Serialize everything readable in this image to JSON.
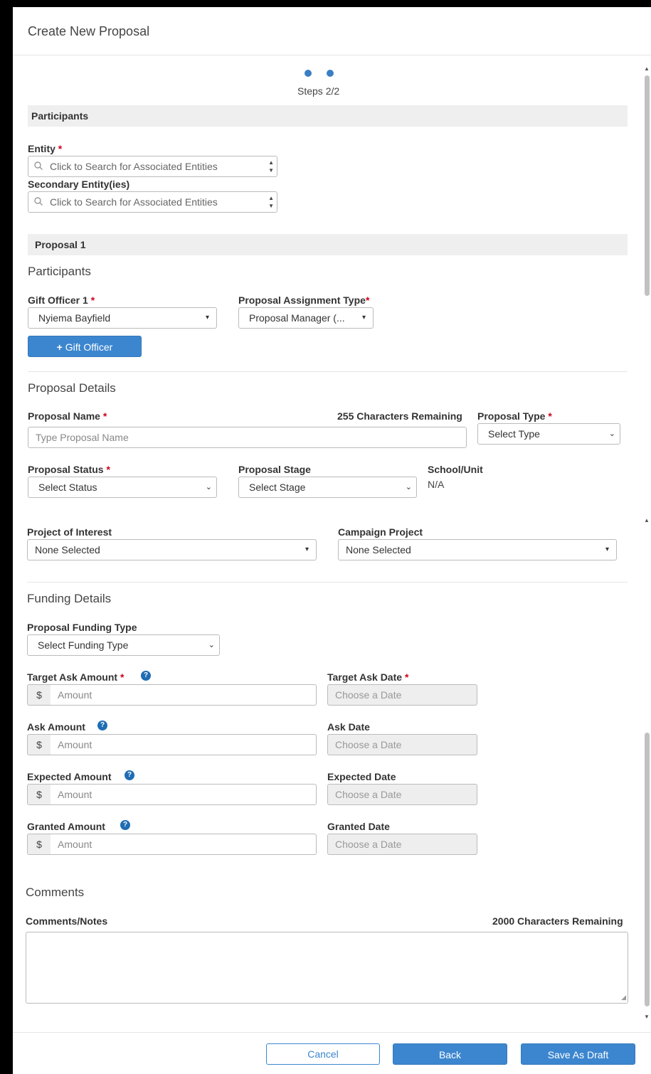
{
  "modal": {
    "title": "Create New Proposal"
  },
  "steps": {
    "text": "Steps 2/2"
  },
  "participants_section": {
    "title": "Participants",
    "entity_label": "Entity",
    "entity_placeholder": "Click to Search for Associated Entities",
    "secondary_label": "Secondary Entity(ies)",
    "secondary_placeholder": "Click to Search for Associated Entities",
    "required_mark": "*"
  },
  "proposal_section": {
    "title": "Proposal 1",
    "participants_subhead": "Participants",
    "gift_officer_label": "Gift Officer 1",
    "gift_officer_value": "Nyiema Bayfield",
    "assignment_type_label": "Proposal Assignment Type",
    "assignment_type_value": "Proposal Manager (...",
    "add_gift_officer_button": "Gift Officer",
    "details_subhead": "Proposal Details",
    "proposal_name_label": "Proposal Name",
    "proposal_name_remaining": "255 Characters Remaining",
    "proposal_name_placeholder": "Type Proposal Name",
    "proposal_type_label": "Proposal Type",
    "proposal_type_value": "Select Type",
    "status_label": "Proposal Status",
    "status_value": "Select Status",
    "stage_label": "Proposal Stage",
    "stage_value": "Select Stage",
    "school_label": "School/Unit",
    "school_value": "N/A",
    "project_interest_label": "Project of Interest",
    "project_interest_value": "None Selected",
    "campaign_project_label": "Campaign Project",
    "campaign_project_value": "None Selected"
  },
  "funding": {
    "subhead": "Funding Details",
    "funding_type_label": "Proposal Funding Type",
    "funding_type_value": "Select Funding Type",
    "currency_symbol": "$",
    "amount_placeholder": "Amount",
    "date_placeholder": "Choose a Date",
    "target_ask_amount_label": "Target Ask Amount",
    "target_ask_date_label": "Target Ask Date",
    "ask_amount_label": "Ask Amount",
    "ask_date_label": "Ask Date",
    "expected_amount_label": "Expected Amount",
    "expected_date_label": "Expected Date",
    "granted_amount_label": "Granted Amount",
    "granted_date_label": "Granted Date",
    "help_glyph": "?"
  },
  "comments": {
    "subhead": "Comments",
    "notes_label": "Comments/Notes",
    "remaining": "2000 Characters Remaining"
  },
  "footer": {
    "cancel": "Cancel",
    "back": "Back",
    "save_draft": "Save As Draft"
  },
  "colors": {
    "accent": "#3c86cf",
    "required": "#d0021b",
    "help": "#1f6db3"
  }
}
